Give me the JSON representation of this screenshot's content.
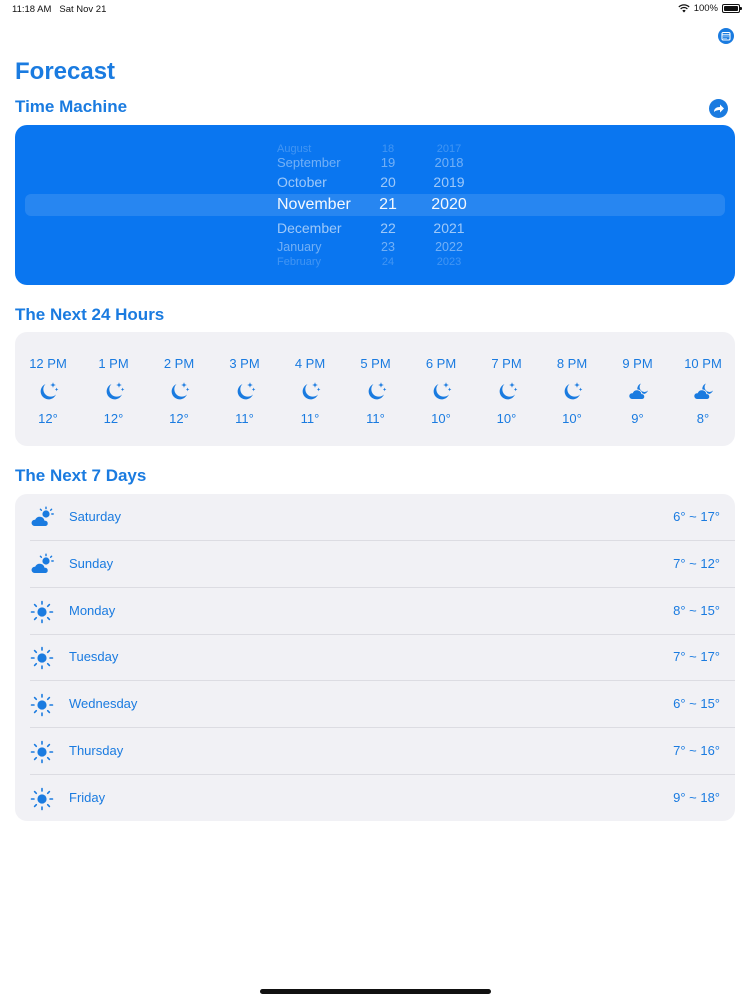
{
  "status_bar": {
    "time": "11:18 AM",
    "date": "Sat Nov 21",
    "battery": "100%"
  },
  "header": {
    "title": "Forecast"
  },
  "icons": {
    "calendar": "calendar-icon",
    "share": "share-arrow-icon",
    "moon_stars": "moon-stars-icon",
    "cloud_moon": "cloud-moon-icon",
    "cloud_sun": "cloud-sun-icon",
    "sun": "sun-icon"
  },
  "colors": {
    "accent": "#1a7be0",
    "picker_bg": "#0a76f0",
    "card_bg": "#f1f1f5"
  },
  "time_machine": {
    "title": "Time Machine",
    "rows": [
      {
        "month": "August",
        "day": "18",
        "year": "2017"
      },
      {
        "month": "September",
        "day": "19",
        "year": "2018"
      },
      {
        "month": "October",
        "day": "20",
        "year": "2019"
      },
      {
        "month": "November",
        "day": "21",
        "year": "2020"
      },
      {
        "month": "December",
        "day": "22",
        "year": "2021"
      },
      {
        "month": "January",
        "day": "23",
        "year": "2022"
      },
      {
        "month": "February",
        "day": "24",
        "year": "2023"
      }
    ],
    "selected": {
      "month": "November",
      "day": "21",
      "year": "2020"
    }
  },
  "hourly": {
    "title": "The Next 24 Hours",
    "items": [
      {
        "time": "12 PM",
        "icon": "moon-stars-icon",
        "temp": "12°"
      },
      {
        "time": "1 PM",
        "icon": "moon-stars-icon",
        "temp": "12°"
      },
      {
        "time": "2 PM",
        "icon": "moon-stars-icon",
        "temp": "12°"
      },
      {
        "time": "3 PM",
        "icon": "moon-stars-icon",
        "temp": "11°"
      },
      {
        "time": "4 PM",
        "icon": "moon-stars-icon",
        "temp": "11°"
      },
      {
        "time": "5 PM",
        "icon": "moon-stars-icon",
        "temp": "11°"
      },
      {
        "time": "6 PM",
        "icon": "moon-stars-icon",
        "temp": "10°"
      },
      {
        "time": "7 PM",
        "icon": "moon-stars-icon",
        "temp": "10°"
      },
      {
        "time": "8 PM",
        "icon": "moon-stars-icon",
        "temp": "10°"
      },
      {
        "time": "9 PM",
        "icon": "cloud-moon-icon",
        "temp": "9°"
      },
      {
        "time": "10 PM",
        "icon": "cloud-moon-icon",
        "temp": "8°"
      }
    ]
  },
  "daily": {
    "title": "The Next 7 Days",
    "items": [
      {
        "day": "Saturday",
        "icon": "cloud-sun-icon",
        "range": "6° ~ 17°"
      },
      {
        "day": "Sunday",
        "icon": "cloud-sun-icon",
        "range": "7° ~ 12°"
      },
      {
        "day": "Monday",
        "icon": "sun-icon",
        "range": "8° ~ 15°"
      },
      {
        "day": "Tuesday",
        "icon": "sun-icon",
        "range": "7° ~ 17°"
      },
      {
        "day": "Wednesday",
        "icon": "sun-icon",
        "range": "6° ~ 15°"
      },
      {
        "day": "Thursday",
        "icon": "sun-icon",
        "range": "7° ~ 16°"
      },
      {
        "day": "Friday",
        "icon": "sun-icon",
        "range": "9° ~ 18°"
      }
    ]
  }
}
